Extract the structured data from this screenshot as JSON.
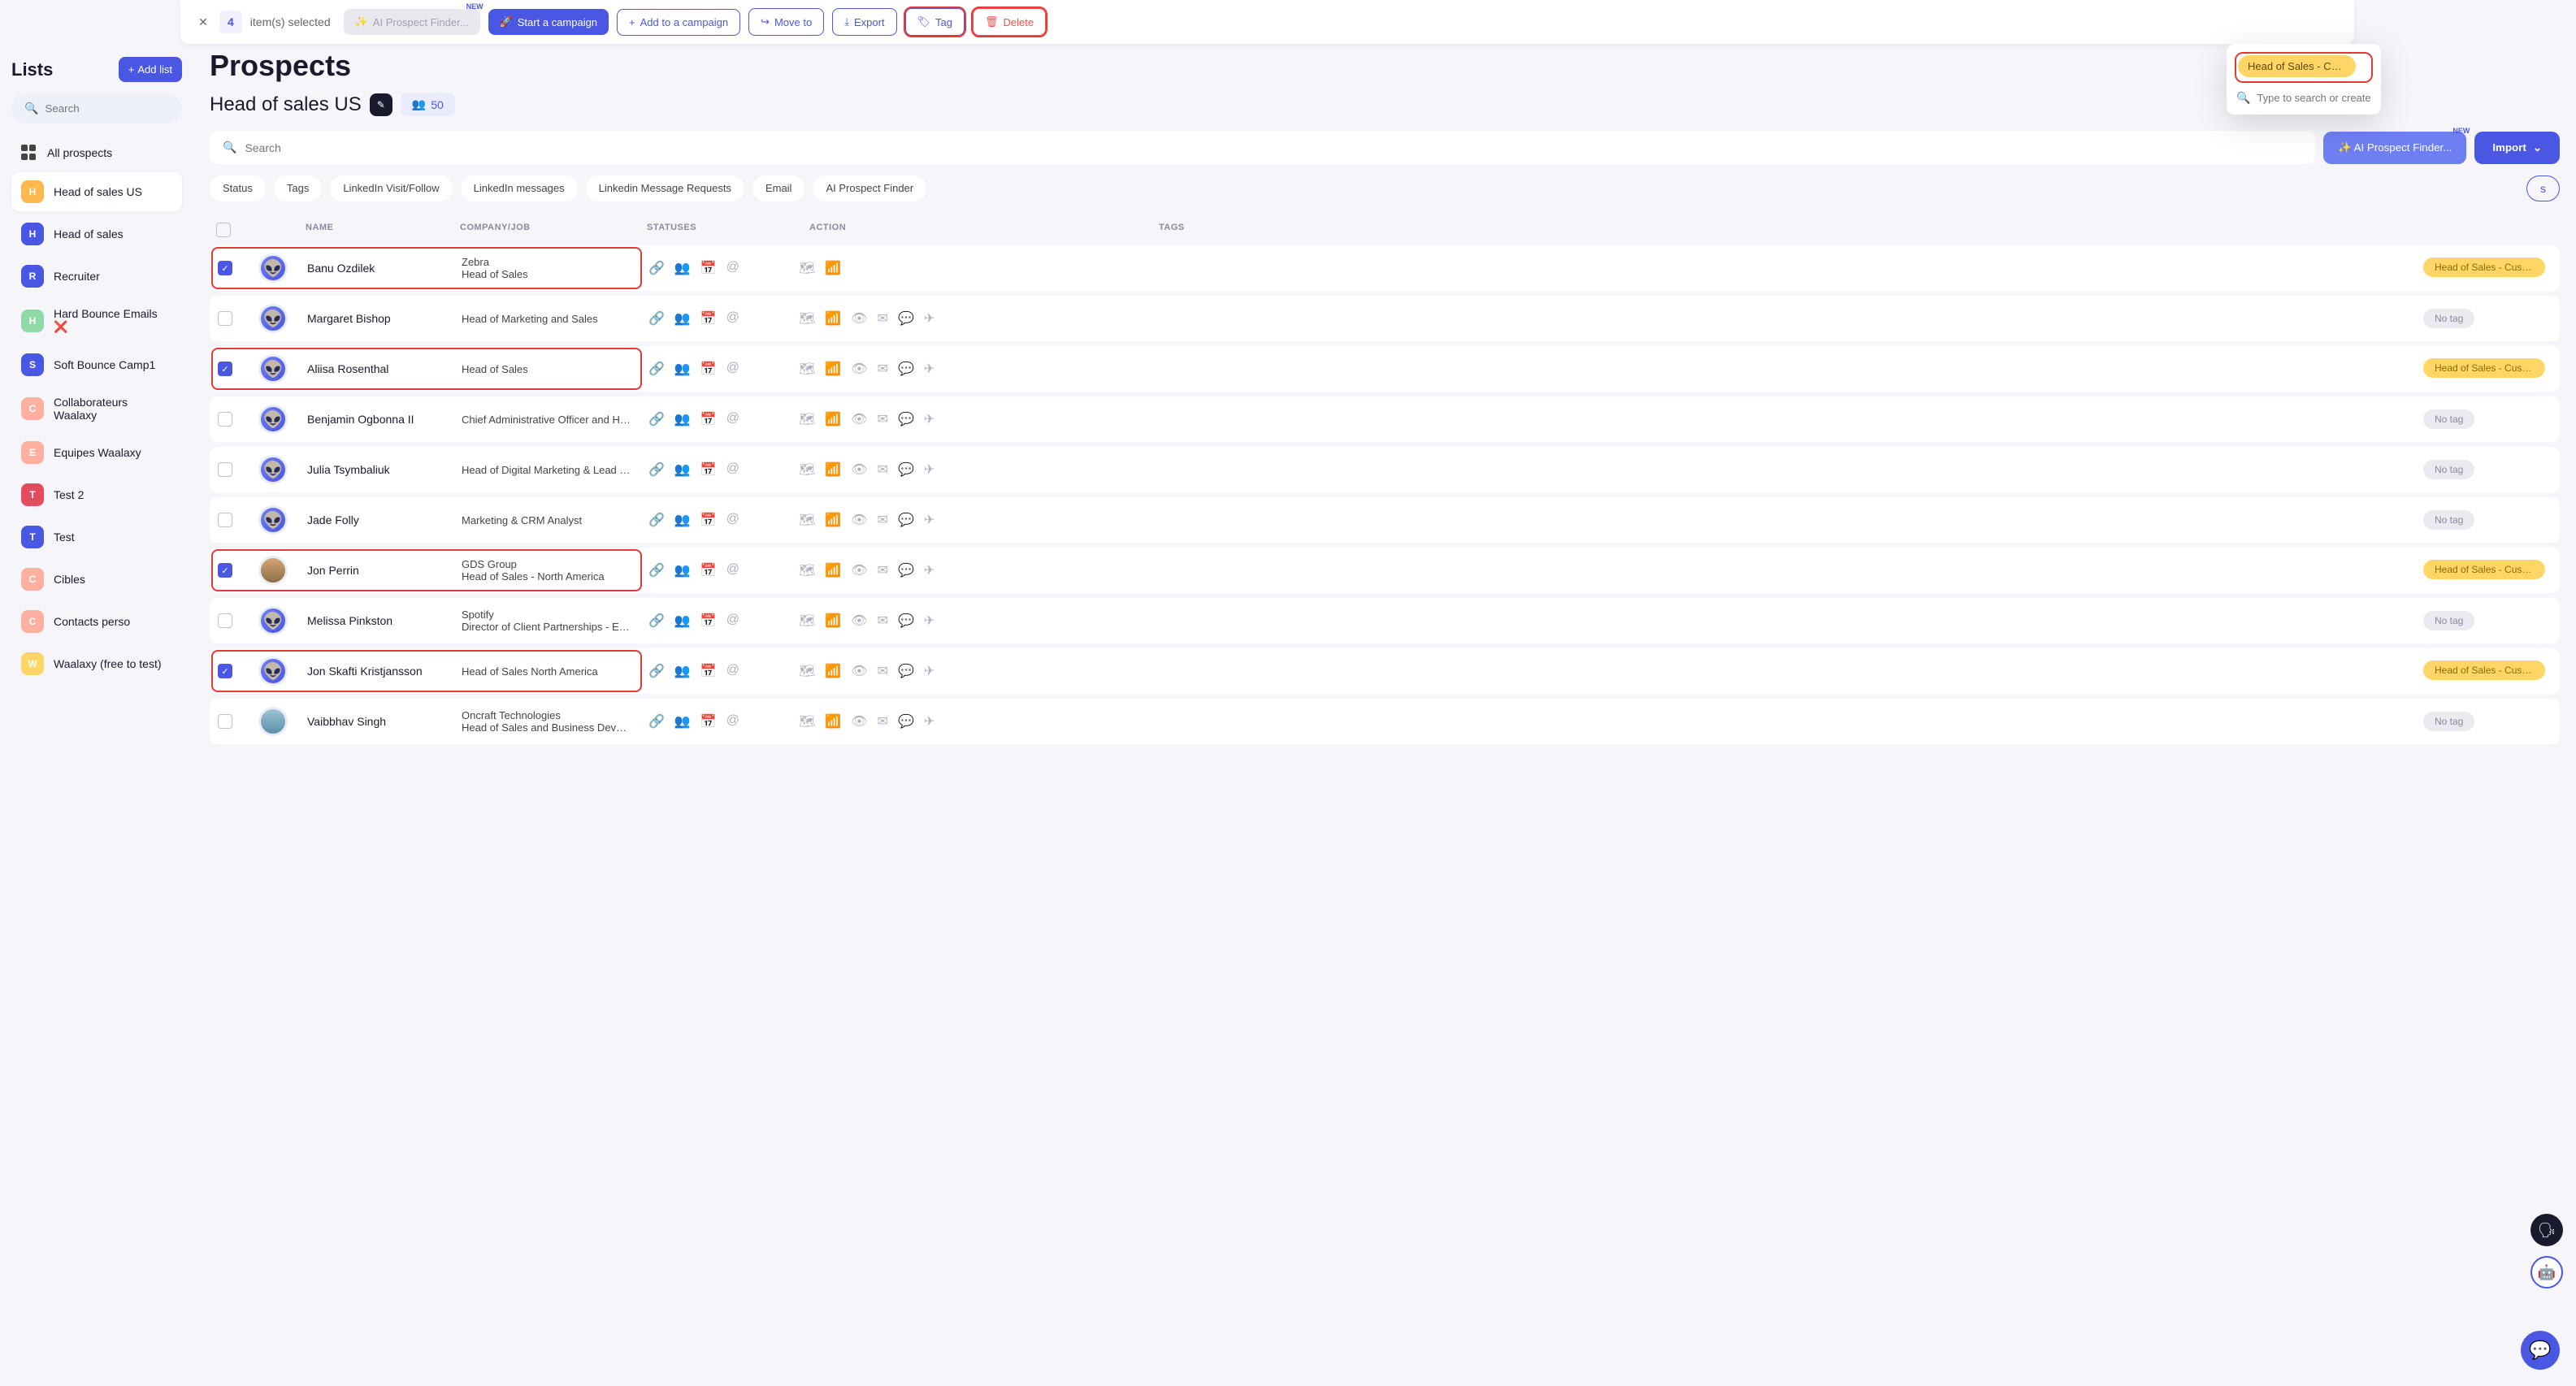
{
  "selectionBar": {
    "count": "4",
    "itemsSelected": "item(s) selected",
    "aiProspect": "AI Prospect Finder...",
    "newLabel": "NEW",
    "startCampaign": "Start a campaign",
    "addToCampaign": "Add to a campaign",
    "moveTo": "Move to",
    "export": "Export",
    "tag": "Tag",
    "delete": "Delete"
  },
  "tagDropdown": {
    "chip": "Head of Sales - Cust…",
    "placeholder": "Type to search or create a"
  },
  "sidebar": {
    "title": "Lists",
    "addList": "Add list",
    "searchPlaceholder": "Search",
    "items": [
      {
        "label": "All prospects",
        "type": "grid",
        "color": ""
      },
      {
        "label": "Head of sales US",
        "type": "letter",
        "letter": "H",
        "color": "#ffb84d"
      },
      {
        "label": "Head of sales",
        "type": "letter",
        "letter": "H",
        "color": "#4957e3"
      },
      {
        "label": "Recruiter",
        "type": "letter",
        "letter": "R",
        "color": "#4957e3"
      },
      {
        "label": "Hard Bounce Emails ❌",
        "type": "letter",
        "letter": "H",
        "color": "#8fd9a8"
      },
      {
        "label": "Soft Bounce Camp1",
        "type": "letter",
        "letter": "S",
        "color": "#4957e3"
      },
      {
        "label": "Collaborateurs Waalaxy",
        "type": "letter",
        "letter": "C",
        "color": "#ffb0a0"
      },
      {
        "label": "Equipes Waalaxy",
        "type": "letter",
        "letter": "E",
        "color": "#ffb0a0"
      },
      {
        "label": "Test 2",
        "type": "letter",
        "letter": "T",
        "color": "#e64a5f"
      },
      {
        "label": "Test",
        "type": "letter",
        "letter": "T",
        "color": "#4957e3"
      },
      {
        "label": "Cibles",
        "type": "letter",
        "letter": "C",
        "color": "#ffb0a0"
      },
      {
        "label": "Contacts perso",
        "type": "letter",
        "letter": "C",
        "color": "#ffb0a0"
      },
      {
        "label": "Waalaxy (free to test)",
        "type": "letter",
        "letter": "W",
        "color": "#ffd666"
      }
    ]
  },
  "main": {
    "pageTitle": "Prospects",
    "subtitle": "Head of sales US",
    "countBadge": "50",
    "searchPlaceholder": "Search",
    "aiFinder": "AI Prospect Finder...",
    "newLabel": "NEW",
    "import": "Import",
    "filters": [
      "Status",
      "Tags",
      "LinkedIn Visit/Follow",
      "LinkedIn messages",
      "Linkedin Message Requests",
      "Email",
      "AI Prospect Finder"
    ],
    "cornerChip": "s"
  },
  "table": {
    "headers": {
      "name": "NAME",
      "company": "COMPANY/JOB",
      "statuses": "STATUSES",
      "actions": "ACTION",
      "tags": "TAGS"
    },
    "rows": [
      {
        "checked": true,
        "avatar": "alien",
        "name": "Banu Ozdilek",
        "company": "Zebra",
        "job": "Head of Sales",
        "tag": "Head of Sales - Cust…",
        "shortActions": true
      },
      {
        "checked": false,
        "avatar": "alien",
        "name": "Margaret Bishop",
        "company": "",
        "job": "Head of Marketing and Sales",
        "tag": ""
      },
      {
        "checked": true,
        "avatar": "alien",
        "name": "Aliisa Rosenthal",
        "company": "",
        "job": "Head of Sales",
        "tag": "Head of Sales - Cust…"
      },
      {
        "checked": false,
        "avatar": "alien",
        "name": "Benjamin Ogbonna II",
        "company": "",
        "job": "Chief Administrative Officer and Head of …",
        "tag": ""
      },
      {
        "checked": false,
        "avatar": "alien",
        "name": "Julia Tsymbaliuk",
        "company": "",
        "job": "Head of Digital Marketing & Lead Genera…",
        "tag": ""
      },
      {
        "checked": false,
        "avatar": "alien",
        "name": "Jade Folly",
        "company": "",
        "job": "Marketing & CRM Analyst",
        "tag": ""
      },
      {
        "checked": true,
        "avatar": "photo1",
        "name": "Jon Perrin",
        "company": "GDS Group",
        "job": "Head of Sales - North America",
        "tag": "Head of Sales - Cust…"
      },
      {
        "checked": false,
        "avatar": "alien",
        "name": "Melissa Pinkston",
        "company": "Spotify",
        "job": "Director of Client Partnerships - East at …",
        "tag": ""
      },
      {
        "checked": true,
        "avatar": "alien",
        "name": "Jon Skafti Kristjansson",
        "company": "",
        "job": "Head of Sales North America",
        "tag": "Head of Sales - Cust…"
      },
      {
        "checked": false,
        "avatar": "photo2",
        "name": "Vaibbhav Singh",
        "company": "Oncraft Technologies",
        "job": "Head of Sales and Business Development",
        "tag": ""
      }
    ],
    "noTag": "No tag"
  }
}
